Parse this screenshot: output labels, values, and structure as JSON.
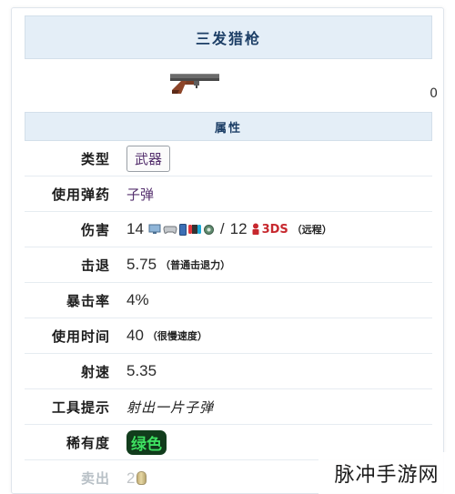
{
  "infobox": {
    "title": "三发猎枪",
    "section_title": "属性",
    "edge_glyph": "0",
    "rows": [
      {
        "label": "类型",
        "value": "武器"
      },
      {
        "label": "使用弹药",
        "value": "子弹"
      },
      {
        "label": "伤害",
        "value_main": "14",
        "value_alt": "12",
        "value_alt_platform": "3DS",
        "note": "（远程）"
      },
      {
        "label": "击退",
        "value": "5.75",
        "note": "（普通击退力）"
      },
      {
        "label": "暴击率",
        "value": "4%"
      },
      {
        "label": "使用时间",
        "value": "40",
        "note": "（很慢速度）"
      },
      {
        "label": "射速",
        "value": "5.35"
      },
      {
        "label": "工具提示",
        "value": "射出一片子弹"
      },
      {
        "label": "稀有度",
        "value": "绿色"
      },
      {
        "label": "卖出",
        "value": "2"
      }
    ],
    "separator": "/",
    "platform_icons": [
      "desktop-icon",
      "gamepad-icon",
      "mobile-icon",
      "switch-icon",
      "gear-icon",
      "3ds-icon"
    ],
    "colors": {
      "header_bg": "#e4eef7",
      "header_text": "#1c3e66",
      "link_text": "#55306e",
      "rarity_green": "#3ee061",
      "threeds_red": "#c7282e"
    }
  },
  "watermark": {
    "text": "脉冲手游网"
  }
}
